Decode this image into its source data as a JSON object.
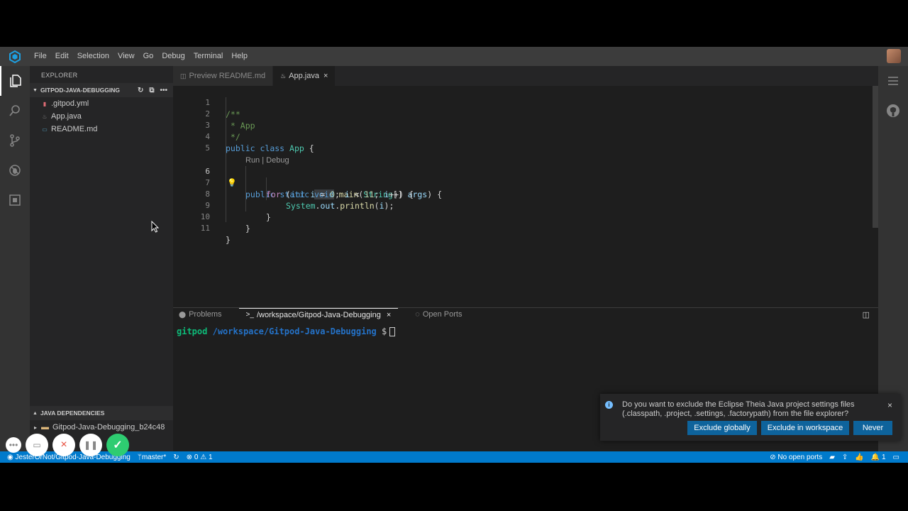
{
  "menu": [
    "File",
    "Edit",
    "Selection",
    "View",
    "Go",
    "Debug",
    "Terminal",
    "Help"
  ],
  "sidebar": {
    "title": "EXPLORER",
    "workspace": "GITPOD-JAVA-DEBUGGING",
    "files": [
      {
        "name": ".gitpod.yml",
        "icon": "yaml-icon",
        "color": "#e06c75"
      },
      {
        "name": "App.java",
        "icon": "java-icon",
        "color": "#888888"
      },
      {
        "name": "README.md",
        "icon": "markdown-icon",
        "color": "#519aba"
      }
    ],
    "java_dependencies_title": "JAVA DEPENDENCIES",
    "dependency_item": "Gitpod-Java-Debugging_b24c48"
  },
  "tabs": [
    {
      "label": "Preview README.md",
      "active": false
    },
    {
      "label": "App.java",
      "active": true
    }
  ],
  "editor": {
    "lines": [
      "1",
      "2",
      "3",
      "4",
      "5",
      "6",
      "7",
      "8",
      "9",
      "10",
      "11"
    ],
    "codelens": "Run | Debug"
  },
  "panel": {
    "tabs": [
      "Problems",
      "/workspace/Gitpod-Java-Debugging",
      "Open Ports"
    ],
    "terminal_user": "gitpod",
    "terminal_path": "/workspace/Gitpod-Java-Debugging",
    "terminal_prompt": "$"
  },
  "notification": {
    "text": "Do you want to exclude the Eclipse Theia Java project settings files (.classpath, .project, .settings, .factorypath) from the file explorer?",
    "buttons": [
      "Exclude globally",
      "Exclude in workspace",
      "Never"
    ]
  },
  "statusbar": {
    "repo": "JesterOrNot/Gitpod-Java-Debugging",
    "branch": "master*",
    "errors": "0",
    "warnings": "1",
    "ports": "No open ports",
    "notifications": "1"
  },
  "colors": {
    "accent": "#007acc",
    "button": "#0e639c",
    "activity": "#333333"
  }
}
